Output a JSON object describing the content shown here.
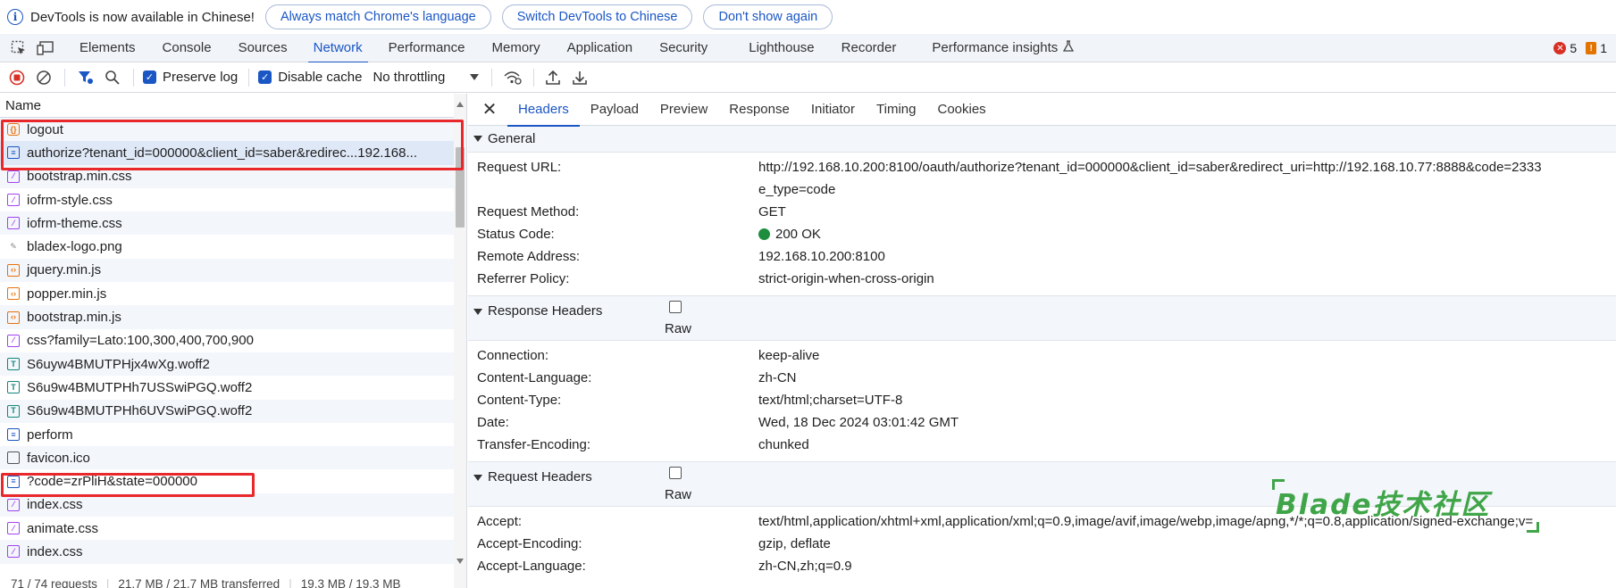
{
  "infobar": {
    "message": "DevTools is now available in Chinese!",
    "buttons": [
      "Always match Chrome's language",
      "Switch DevTools to Chinese",
      "Don't show again"
    ]
  },
  "tabs": [
    "Elements",
    "Console",
    "Sources",
    "Network",
    "Performance",
    "Memory",
    "Application",
    "Security",
    "Lighthouse",
    "Recorder",
    "Performance insights"
  ],
  "active_tab": "Network",
  "badges": {
    "errors": "5",
    "warnings": "1"
  },
  "toolbar": {
    "preserve_log": "Preserve log",
    "disable_cache": "Disable cache",
    "throttling": "No throttling"
  },
  "list": {
    "header": "Name",
    "rows": [
      {
        "name": "logout",
        "type": "fetch"
      },
      {
        "name": "authorize?tenant_id=000000&client_id=saber&redirec...192.168...",
        "type": "doc"
      },
      {
        "name": "bootstrap.min.css",
        "type": "css"
      },
      {
        "name": "iofrm-style.css",
        "type": "css"
      },
      {
        "name": "iofrm-theme.css",
        "type": "css"
      },
      {
        "name": "bladex-logo.png",
        "type": "img"
      },
      {
        "name": "jquery.min.js",
        "type": "js"
      },
      {
        "name": "popper.min.js",
        "type": "js"
      },
      {
        "name": "bootstrap.min.js",
        "type": "js"
      },
      {
        "name": "css?family=Lato:100,300,400,700,900",
        "type": "css"
      },
      {
        "name": "S6uyw4BMUTPHjx4wXg.woff2",
        "type": "font"
      },
      {
        "name": "S6u9w4BMUTPHh7USSwiPGQ.woff2",
        "type": "font"
      },
      {
        "name": "S6u9w4BMUTPHh6UVSwiPGQ.woff2",
        "type": "font"
      },
      {
        "name": "perform",
        "type": "doc"
      },
      {
        "name": "favicon.ico",
        "type": "other"
      },
      {
        "name": "?code=zrPliH&state=000000",
        "type": "doc"
      },
      {
        "name": "index.css",
        "type": "css"
      },
      {
        "name": "animate.css",
        "type": "css"
      },
      {
        "name": "index.css",
        "type": "css"
      }
    ],
    "status": [
      "71 / 74 requests",
      "21.7 MB / 21.7 MB transferred",
      "19.3 MB / 19.3 MB"
    ]
  },
  "detail": {
    "tabs": [
      "Headers",
      "Payload",
      "Preview",
      "Response",
      "Initiator",
      "Timing",
      "Cookies"
    ],
    "active_tab": "Headers",
    "general": {
      "title": "General",
      "rows": [
        {
          "k": "Request URL:",
          "v": "http://192.168.10.200:8100/oauth/authorize?tenant_id=000000&client_id=saber&redirect_uri=http://192.168.10.77:8888&code=2333"
        },
        {
          "k": "",
          "v": "e_type=code"
        },
        {
          "k": "Request Method:",
          "v": "GET"
        },
        {
          "k": "Status Code:",
          "v": "200 OK"
        },
        {
          "k": "Remote Address:",
          "v": "192.168.10.200:8100"
        },
        {
          "k": "Referrer Policy:",
          "v": "strict-origin-when-cross-origin"
        }
      ]
    },
    "response_headers": {
      "title": "Response Headers",
      "raw": "Raw",
      "rows": [
        {
          "k": "Connection:",
          "v": "keep-alive"
        },
        {
          "k": "Content-Language:",
          "v": "zh-CN"
        },
        {
          "k": "Content-Type:",
          "v": "text/html;charset=UTF-8"
        },
        {
          "k": "Date:",
          "v": "Wed, 18 Dec 2024 03:01:42 GMT"
        },
        {
          "k": "Transfer-Encoding:",
          "v": "chunked"
        }
      ]
    },
    "request_headers": {
      "title": "Request Headers",
      "raw": "Raw",
      "rows": [
        {
          "k": "Accept:",
          "v": "text/html,application/xhtml+xml,application/xml;q=0.9,image/avif,image/webp,image/apng,*/*;q=0.8,application/signed-exchange;v="
        },
        {
          "k": "Accept-Encoding:",
          "v": "gzip, deflate"
        },
        {
          "k": "Accept-Language:",
          "v": "zh-CN,zh;q=0.9"
        }
      ]
    }
  },
  "watermark": "Blade技术社区",
  "colors": {
    "accent": "#1a56c4",
    "highlight_box": "#e8282b",
    "watermark": "#3fa548"
  }
}
